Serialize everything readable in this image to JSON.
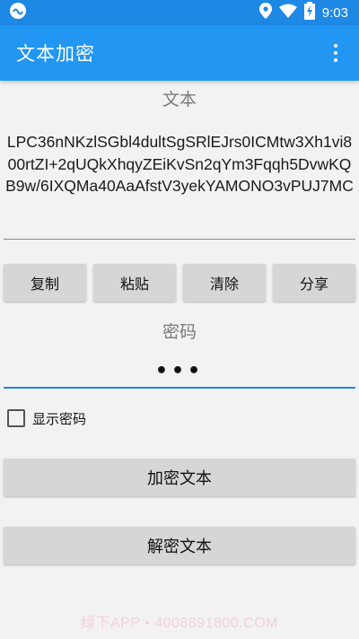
{
  "status_bar": {
    "time": "9:03",
    "icons": [
      "app-notification-icon",
      "location-icon",
      "wifi-icon",
      "battery-charging-icon"
    ]
  },
  "app_bar": {
    "title": "文本加密",
    "overflow_icon": "more-vert-icon"
  },
  "text_section": {
    "label": "文本",
    "content": "LPC36nNKzlSGbl4dultSgSRlEJrs0ICMtw3Xh1vi800rtZI+2qUQkXhqyZEiKvSn2qYm3Fqqh5DvwKQB9w/6IXQMa40AaAfstV3yekYAMONO3vPUJ7MC"
  },
  "action_buttons": {
    "copy": "复制",
    "paste": "粘贴",
    "clear": "清除",
    "share": "分享"
  },
  "password_section": {
    "label": "密码",
    "value": "•••"
  },
  "show_password": {
    "label": "显示密码",
    "checked": false
  },
  "encrypt_button": "加密文本",
  "decrypt_button": "解密文本",
  "watermark": "绿下APP • 4008891800.COM",
  "colors": {
    "primary": "#2196f3",
    "status_bar": "#1e88e5",
    "background": "#f2f2f2",
    "button": "#d6d6d6",
    "label": "#7a7a7a"
  }
}
